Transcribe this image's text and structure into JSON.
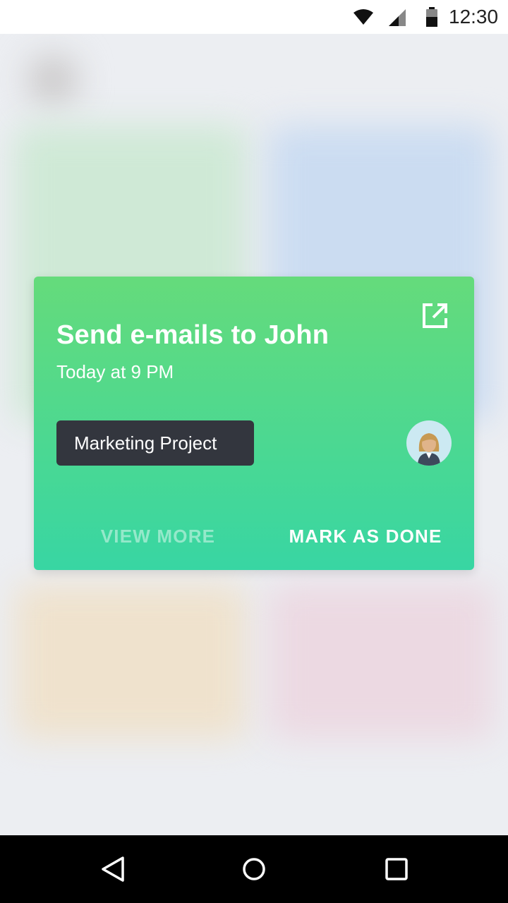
{
  "status_bar": {
    "time": "12:30",
    "icons": [
      "wifi-icon",
      "signal-icon",
      "battery-icon"
    ]
  },
  "task_card": {
    "title": "Send e-mails to John",
    "time": "Today at 9 PM",
    "project_tag": "Marketing Project",
    "assignee_icon": "person-avatar-icon",
    "open_icon": "open-in-new-icon",
    "view_more_label": "VIEW MORE",
    "mark_done_label": "MARK AS DONE",
    "gradient": [
      "#65db7b",
      "#38d6a3"
    ],
    "tag_color": "#33363e"
  },
  "nav_bar": {
    "icons": [
      "back-icon",
      "home-icon",
      "recents-icon"
    ]
  }
}
